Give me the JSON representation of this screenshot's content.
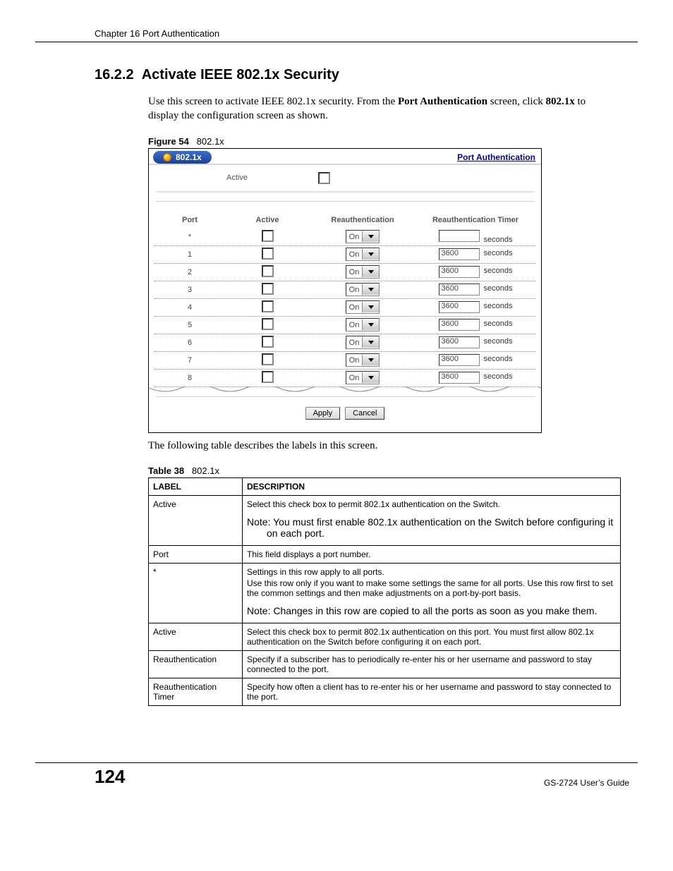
{
  "chapter_header": "Chapter 16 Port Authentication",
  "section_number": "16.2.2",
  "section_title": "Activate IEEE 802.1x Security",
  "intro_pre": "Use this screen to activate IEEE 802.1x security. From the ",
  "intro_bold1": "Port Authentication",
  "intro_mid": " screen, click ",
  "intro_bold2": "802.1x",
  "intro_post": " to display the configuration screen as shown.",
  "figure": {
    "label": "Figure 54",
    "caption": "802.1x",
    "tab_title": "802.1x",
    "link": "Port Authentication",
    "active_label": "Active",
    "columns": {
      "port": "Port",
      "active": "Active",
      "reauth": "Reauthentication",
      "timer": "Reauthentication Timer"
    },
    "select_option": "On",
    "unit": "seconds",
    "rows": [
      {
        "port": "*",
        "timer": ""
      },
      {
        "port": "1",
        "timer": "3600"
      },
      {
        "port": "2",
        "timer": "3600"
      },
      {
        "port": "3",
        "timer": "3600"
      },
      {
        "port": "4",
        "timer": "3600"
      },
      {
        "port": "5",
        "timer": "3600"
      },
      {
        "port": "6",
        "timer": "3600"
      },
      {
        "port": "7",
        "timer": "3600"
      },
      {
        "port": "8",
        "timer": "3600"
      }
    ],
    "apply": "Apply",
    "cancel": "Cancel"
  },
  "after_figure": "The following table describes the labels in this screen.",
  "table": {
    "label": "Table 38",
    "caption": "802.1x",
    "head_label": "LABEL",
    "head_desc": "DESCRIPTION",
    "rows": [
      {
        "label": "Active",
        "desc": "Select this check box to permit 802.1x authentication on the Switch.",
        "note": "Note: You must first enable 802.1x authentication on the Switch before configuring it on each port."
      },
      {
        "label": "Port",
        "desc": "This field displays a port number."
      },
      {
        "label": "*",
        "desc": "Settings in this row apply to all ports.",
        "desc2": "Use this row only if you want to make some settings the same for all ports. Use this row first to set the common settings and then make adjustments on a port-by-port basis.",
        "note": "Note: Changes in this row are copied to all the ports as soon as you make them."
      },
      {
        "label": "Active",
        "desc": "Select this check box to permit 802.1x authentication on this port. You must first allow 802.1x authentication on the Switch before configuring it on each port."
      },
      {
        "label": "Reauthentication",
        "desc": "Specify if a subscriber has to periodically re-enter his or her username and password to stay connected to the port."
      },
      {
        "label": "Reauthentication Timer",
        "desc": "Specify how often a client has to re-enter his or her username and password to stay connected to the port."
      }
    ]
  },
  "footer": {
    "page": "124",
    "guide": "GS-2724 User’s Guide"
  }
}
